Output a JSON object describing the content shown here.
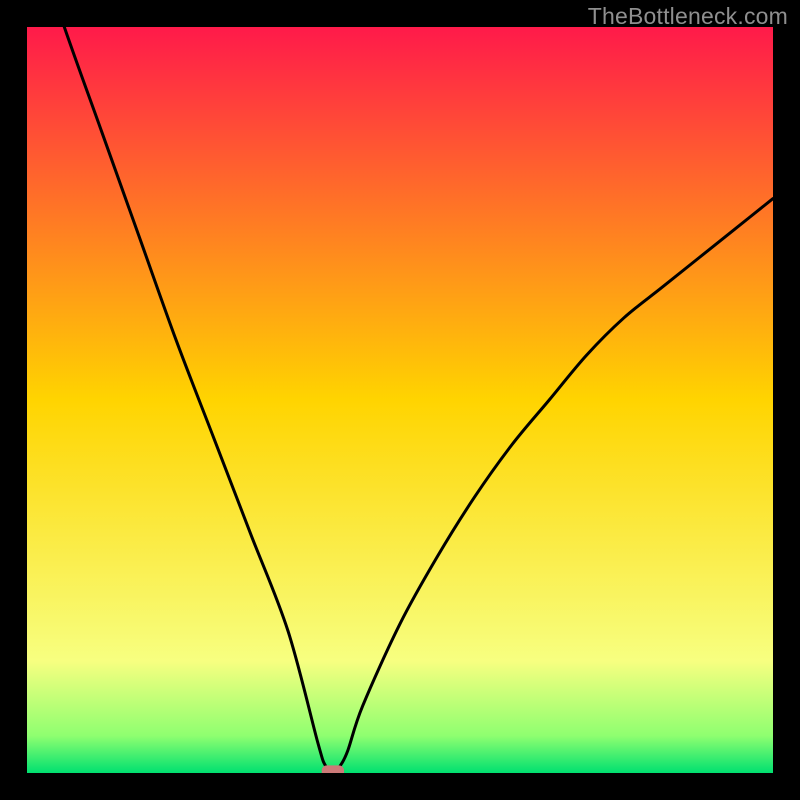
{
  "watermark": "TheBottleneck.com",
  "colors": {
    "frame": "#000000",
    "top": "#ff1a4a",
    "mid": "#ffd400",
    "green_top": "#bfff60",
    "green_bottom": "#00e070",
    "curve": "#000000",
    "marker": "#cc7a78"
  },
  "chart_data": {
    "type": "line",
    "title": "",
    "xlabel": "",
    "ylabel": "",
    "xlim": [
      0,
      100
    ],
    "ylim": [
      0,
      100
    ],
    "x_min_at": 41,
    "marker": {
      "x": 41,
      "y": 0,
      "w": 3.0,
      "h": 1.5
    },
    "series": [
      {
        "name": "bottleneck-curve",
        "x": [
          0,
          5,
          10,
          15,
          20,
          25,
          30,
          35,
          39,
          40,
          41,
          42,
          43,
          45,
          50,
          55,
          60,
          65,
          70,
          75,
          80,
          85,
          90,
          95,
          100
        ],
        "y": [
          115,
          100,
          86,
          72,
          58,
          45,
          32,
          19,
          4,
          1,
          0,
          1,
          3,
          9,
          20,
          29,
          37,
          44,
          50,
          56,
          61,
          65,
          69,
          73,
          77
        ]
      }
    ],
    "gradient_stops": [
      {
        "offset": 0,
        "color": "#ff1a4a"
      },
      {
        "offset": 50,
        "color": "#ffd400"
      },
      {
        "offset": 85,
        "color": "#f7ff80"
      },
      {
        "offset": 95,
        "color": "#8fff70"
      },
      {
        "offset": 100,
        "color": "#00e070"
      }
    ]
  }
}
